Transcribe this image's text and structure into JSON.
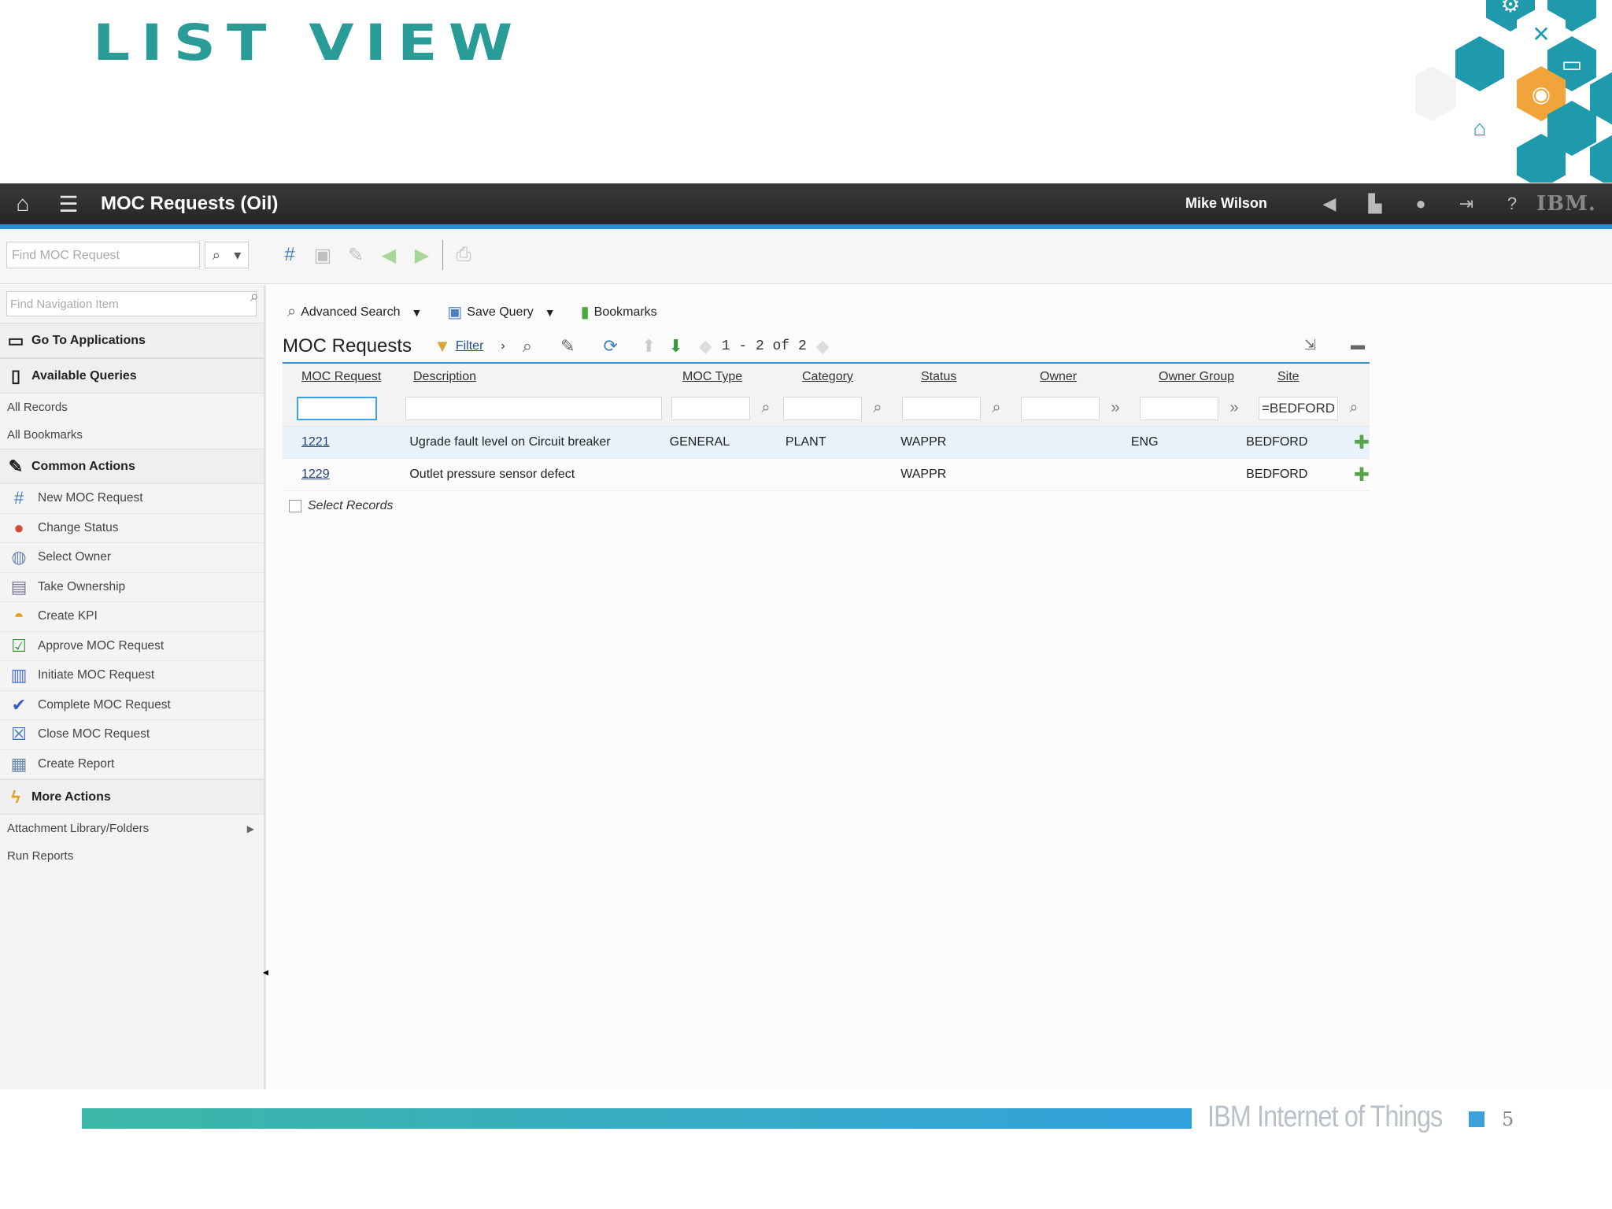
{
  "slide": {
    "title": "List View",
    "footer_brand": "IBM Internet of Things",
    "page_number": "5",
    "colors": {
      "title": "#2a9c98",
      "accent": "#2b8fd0",
      "hex_teal": "#1f9aad",
      "hex_orange": "#f0a43a"
    }
  },
  "topbar": {
    "app_title": "MOC Requests (Oil)",
    "user_name": "Mike Wilson",
    "icons": [
      "home-icon",
      "menu-icon",
      "megaphone-icon",
      "chart-icon",
      "person-icon",
      "logout-icon",
      "help-icon"
    ],
    "brand_logo": "IBM."
  },
  "toolbar": {
    "find_placeholder": "Find MOC Request",
    "tool_icons": [
      "new-record-icon",
      "save-icon",
      "edit-icon",
      "back-arrow-icon",
      "forward-arrow-icon",
      "print-icon"
    ]
  },
  "sidebar": {
    "search_placeholder": "Find Navigation Item",
    "go_to_apps": "Go To Applications",
    "available_queries": "Available Queries",
    "queries": [
      "All Records",
      "All Bookmarks"
    ],
    "common_actions": "Common Actions",
    "actions": [
      {
        "label": "New MOC Request",
        "icon": "new-request-icon"
      },
      {
        "label": "Change Status",
        "icon": "change-status-icon"
      },
      {
        "label": "Select Owner",
        "icon": "select-owner-icon"
      },
      {
        "label": "Take Ownership",
        "icon": "take-ownership-icon"
      },
      {
        "label": "Create KPI",
        "icon": "kpi-gauge-icon"
      },
      {
        "label": "Approve MOC Request",
        "icon": "approve-check-icon"
      },
      {
        "label": "Initiate MOC Request",
        "icon": "initiate-icon"
      },
      {
        "label": "Complete MOC Request",
        "icon": "complete-check-icon"
      },
      {
        "label": "Close MOC Request",
        "icon": "close-x-icon"
      },
      {
        "label": "Create Report",
        "icon": "report-icon"
      }
    ],
    "more_actions": "More Actions",
    "more": [
      "Attachment Library/Folders",
      "Run Reports"
    ]
  },
  "main": {
    "query_bar": {
      "advanced_search": "Advanced Search",
      "save_query": "Save Query",
      "bookmarks": "Bookmarks"
    },
    "list_title": "MOC Requests",
    "filter_label": "Filter",
    "pagination": "1 - 2 of 2",
    "columns": [
      "MOC Request",
      "Description",
      "MOC Type",
      "Category",
      "Status",
      "Owner",
      "Owner Group",
      "Site"
    ],
    "filters": {
      "site": "=BEDFORD"
    },
    "rows": [
      {
        "id": "1221",
        "description": "Ugrade fault level on Circuit breaker",
        "type": "GENERAL",
        "category": "PLANT",
        "status": "WAPPR",
        "owner": "",
        "owner_group": "ENG",
        "site": "BEDFORD"
      },
      {
        "id": "1229",
        "description": "Outlet pressure sensor defect",
        "type": "",
        "category": "",
        "status": "WAPPR",
        "owner": "",
        "owner_group": "",
        "site": "BEDFORD"
      }
    ],
    "select_records": "Select Records"
  }
}
